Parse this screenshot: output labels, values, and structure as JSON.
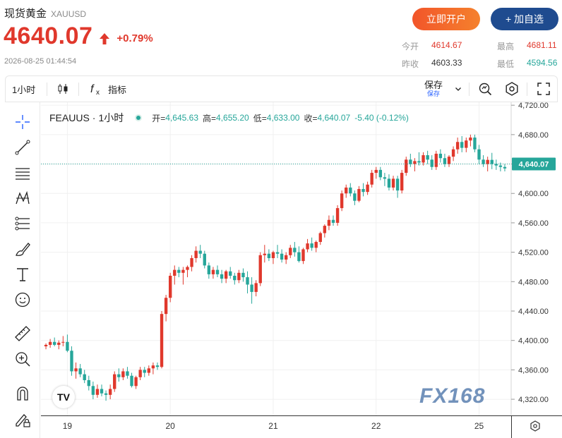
{
  "header": {
    "title": "现货黄金",
    "symbol": "XAUUSD",
    "price": "4640.07",
    "change": "+0.79%",
    "timestamp": "2026-08-25 01:44:54",
    "open_account_label": "立即开户",
    "watchlist_label": "+ 加自选",
    "stats": {
      "open_label": "今开",
      "open_value": "4614.67",
      "high_label": "最高",
      "high_value": "4681.11",
      "prev_close_label": "昨收",
      "prev_close_value": "4603.33",
      "low_label": "最低",
      "low_value": "4594.56"
    }
  },
  "toolbar": {
    "interval_label": "1小时",
    "indicators_label": "指标",
    "save_label": "保存",
    "save_sub_label": "保存"
  },
  "tools": [
    "crosshair-icon",
    "trend-line-icon",
    "horizontal-lines-icon",
    "pattern-icon",
    "fib-icon",
    "brush-icon",
    "text-icon",
    "emoji-icon",
    "ruler-icon",
    "zoom-in-icon",
    "magnet-icon",
    "lock-pencil-icon"
  ],
  "legend": {
    "symbol": "FEAUUS",
    "interval": "1小时",
    "open_label": "开=",
    "open_value": "4,645.63",
    "high_label": "高=",
    "high_value": "4,655.20",
    "low_label": "低=",
    "low_value": "4,633.00",
    "close_label": "收=",
    "close_value": "4,640.07",
    "change_value": "-5.40 (-0.12%)"
  },
  "watermark": "FX168",
  "tv_logo": "TV",
  "colors": {
    "up": "#e0382c",
    "down": "#26a69a",
    "accent": "#2962ff",
    "brand_blue": "#1f4b8f"
  },
  "chart_data": {
    "type": "candlestick",
    "y_tick_labels": [
      "4,720.00",
      "4,680.00",
      "4,640.00",
      "4,600.00",
      "4,560.00",
      "4,520.00",
      "4,480.00",
      "4,440.00",
      "4,400.00",
      "4,360.00",
      "4,320.00"
    ],
    "y_ticks": [
      4720,
      4680,
      4640,
      4600,
      4560,
      4520,
      4480,
      4440,
      4400,
      4360,
      4320
    ],
    "ylim": [
      4298,
      4724
    ],
    "x_tick_labels": [
      "19",
      "20",
      "21",
      "22",
      "25"
    ],
    "x_tick_index": [
      5,
      29,
      53,
      77,
      101
    ],
    "x_count": 108,
    "last_price_label": "4,640.07",
    "last_price": 4640.07,
    "candles": [
      [
        4392,
        4396,
        4388,
        4394
      ],
      [
        4394,
        4402,
        4390,
        4398
      ],
      [
        4398,
        4404,
        4392,
        4394
      ],
      [
        4394,
        4400,
        4388,
        4397
      ],
      [
        4397,
        4406,
        4392,
        4398
      ],
      [
        4398,
        4408,
        4384,
        4386
      ],
      [
        4386,
        4392,
        4352,
        4358
      ],
      [
        4358,
        4370,
        4348,
        4362
      ],
      [
        4362,
        4368,
        4350,
        4354
      ],
      [
        4354,
        4360,
        4342,
        4346
      ],
      [
        4346,
        4352,
        4332,
        4338
      ],
      [
        4338,
        4344,
        4320,
        4326
      ],
      [
        4326,
        4340,
        4322,
        4334
      ],
      [
        4334,
        4340,
        4324,
        4328
      ],
      [
        4328,
        4332,
        4318,
        4326
      ],
      [
        4326,
        4340,
        4320,
        4334
      ],
      [
        4334,
        4358,
        4330,
        4354
      ],
      [
        4354,
        4362,
        4344,
        4350
      ],
      [
        4350,
        4362,
        4346,
        4358
      ],
      [
        4358,
        4364,
        4348,
        4352
      ],
      [
        4352,
        4356,
        4336,
        4338
      ],
      [
        4338,
        4352,
        4334,
        4350
      ],
      [
        4350,
        4364,
        4346,
        4360
      ],
      [
        4360,
        4364,
        4350,
        4356
      ],
      [
        4356,
        4366,
        4352,
        4362
      ],
      [
        4362,
        4370,
        4354,
        4366
      ],
      [
        4366,
        4370,
        4360,
        4364
      ],
      [
        4364,
        4440,
        4362,
        4436
      ],
      [
        4436,
        4462,
        4426,
        4458
      ],
      [
        4458,
        4492,
        4452,
        4488
      ],
      [
        4488,
        4502,
        4476,
        4496
      ],
      [
        4496,
        4500,
        4486,
        4492
      ],
      [
        4492,
        4500,
        4476,
        4496
      ],
      [
        4496,
        4502,
        4486,
        4500
      ],
      [
        4500,
        4516,
        4494,
        4512
      ],
      [
        4512,
        4528,
        4506,
        4522
      ],
      [
        4522,
        4530,
        4512,
        4518
      ],
      [
        4518,
        4522,
        4498,
        4502
      ],
      [
        4502,
        4506,
        4484,
        4490
      ],
      [
        4490,
        4500,
        4484,
        4496
      ],
      [
        4496,
        4502,
        4486,
        4490
      ],
      [
        4490,
        4496,
        4478,
        4484
      ],
      [
        4484,
        4496,
        4478,
        4494
      ],
      [
        4494,
        4500,
        4484,
        4488
      ],
      [
        4488,
        4492,
        4476,
        4482
      ],
      [
        4482,
        4496,
        4478,
        4492
      ],
      [
        4492,
        4498,
        4480,
        4486
      ],
      [
        4486,
        4494,
        4464,
        4476
      ],
      [
        4476,
        4486,
        4450,
        4466
      ],
      [
        4466,
        4482,
        4460,
        4478
      ],
      [
        4478,
        4520,
        4474,
        4516
      ],
      [
        4516,
        4530,
        4506,
        4518
      ],
      [
        4518,
        4524,
        4508,
        4512
      ],
      [
        4512,
        4522,
        4504,
        4520
      ],
      [
        4520,
        4530,
        4512,
        4518
      ],
      [
        4518,
        4524,
        4506,
        4510
      ],
      [
        4510,
        4520,
        4504,
        4516
      ],
      [
        4516,
        4530,
        4512,
        4526
      ],
      [
        4526,
        4534,
        4514,
        4520
      ],
      [
        4520,
        4528,
        4506,
        4508
      ],
      [
        4508,
        4526,
        4504,
        4524
      ],
      [
        4524,
        4538,
        4520,
        4532
      ],
      [
        4532,
        4540,
        4522,
        4526
      ],
      [
        4526,
        4536,
        4520,
        4534
      ],
      [
        4534,
        4548,
        4530,
        4546
      ],
      [
        4546,
        4558,
        4540,
        4556
      ],
      [
        4556,
        4570,
        4550,
        4564
      ],
      [
        4564,
        4570,
        4556,
        4560
      ],
      [
        4560,
        4584,
        4556,
        4580
      ],
      [
        4580,
        4604,
        4576,
        4600
      ],
      [
        4600,
        4612,
        4594,
        4608
      ],
      [
        4608,
        4614,
        4596,
        4600
      ],
      [
        4600,
        4604,
        4584,
        4590
      ],
      [
        4590,
        4610,
        4588,
        4606
      ],
      [
        4606,
        4614,
        4596,
        4602
      ],
      [
        4602,
        4616,
        4598,
        4612
      ],
      [
        4612,
        4632,
        4608,
        4628
      ],
      [
        4628,
        4636,
        4620,
        4632
      ],
      [
        4632,
        4636,
        4618,
        4622
      ],
      [
        4622,
        4628,
        4610,
        4620
      ],
      [
        4620,
        4626,
        4604,
        4608
      ],
      [
        4608,
        4624,
        4604,
        4620
      ],
      [
        4620,
        4624,
        4594,
        4604
      ],
      [
        4604,
        4632,
        4600,
        4628
      ],
      [
        4628,
        4650,
        4624,
        4646
      ],
      [
        4646,
        4654,
        4636,
        4640
      ],
      [
        4640,
        4648,
        4630,
        4644
      ],
      [
        4644,
        4656,
        4638,
        4642
      ],
      [
        4642,
        4656,
        4638,
        4652
      ],
      [
        4652,
        4658,
        4640,
        4646
      ],
      [
        4646,
        4652,
        4632,
        4636
      ],
      [
        4636,
        4658,
        4632,
        4654
      ],
      [
        4654,
        4660,
        4642,
        4648
      ],
      [
        4648,
        4654,
        4636,
        4640
      ],
      [
        4640,
        4652,
        4636,
        4650
      ],
      [
        4650,
        4664,
        4644,
        4660
      ],
      [
        4660,
        4676,
        4654,
        4670
      ],
      [
        4670,
        4678,
        4656,
        4662
      ],
      [
        4662,
        4676,
        4656,
        4672
      ],
      [
        4672,
        4680,
        4664,
        4676
      ],
      [
        4676,
        4680,
        4656,
        4660
      ],
      [
        4660,
        4666,
        4640,
        4646
      ],
      [
        4646,
        4652,
        4636,
        4640
      ],
      [
        4640,
        4650,
        4630,
        4645.63
      ],
      [
        4645.63,
        4655.2,
        4633,
        4640.07
      ],
      [
        4640.07,
        4646,
        4632,
        4638
      ],
      [
        4638,
        4642,
        4630,
        4636
      ],
      [
        4636,
        4640,
        4630,
        4634
      ]
    ]
  }
}
